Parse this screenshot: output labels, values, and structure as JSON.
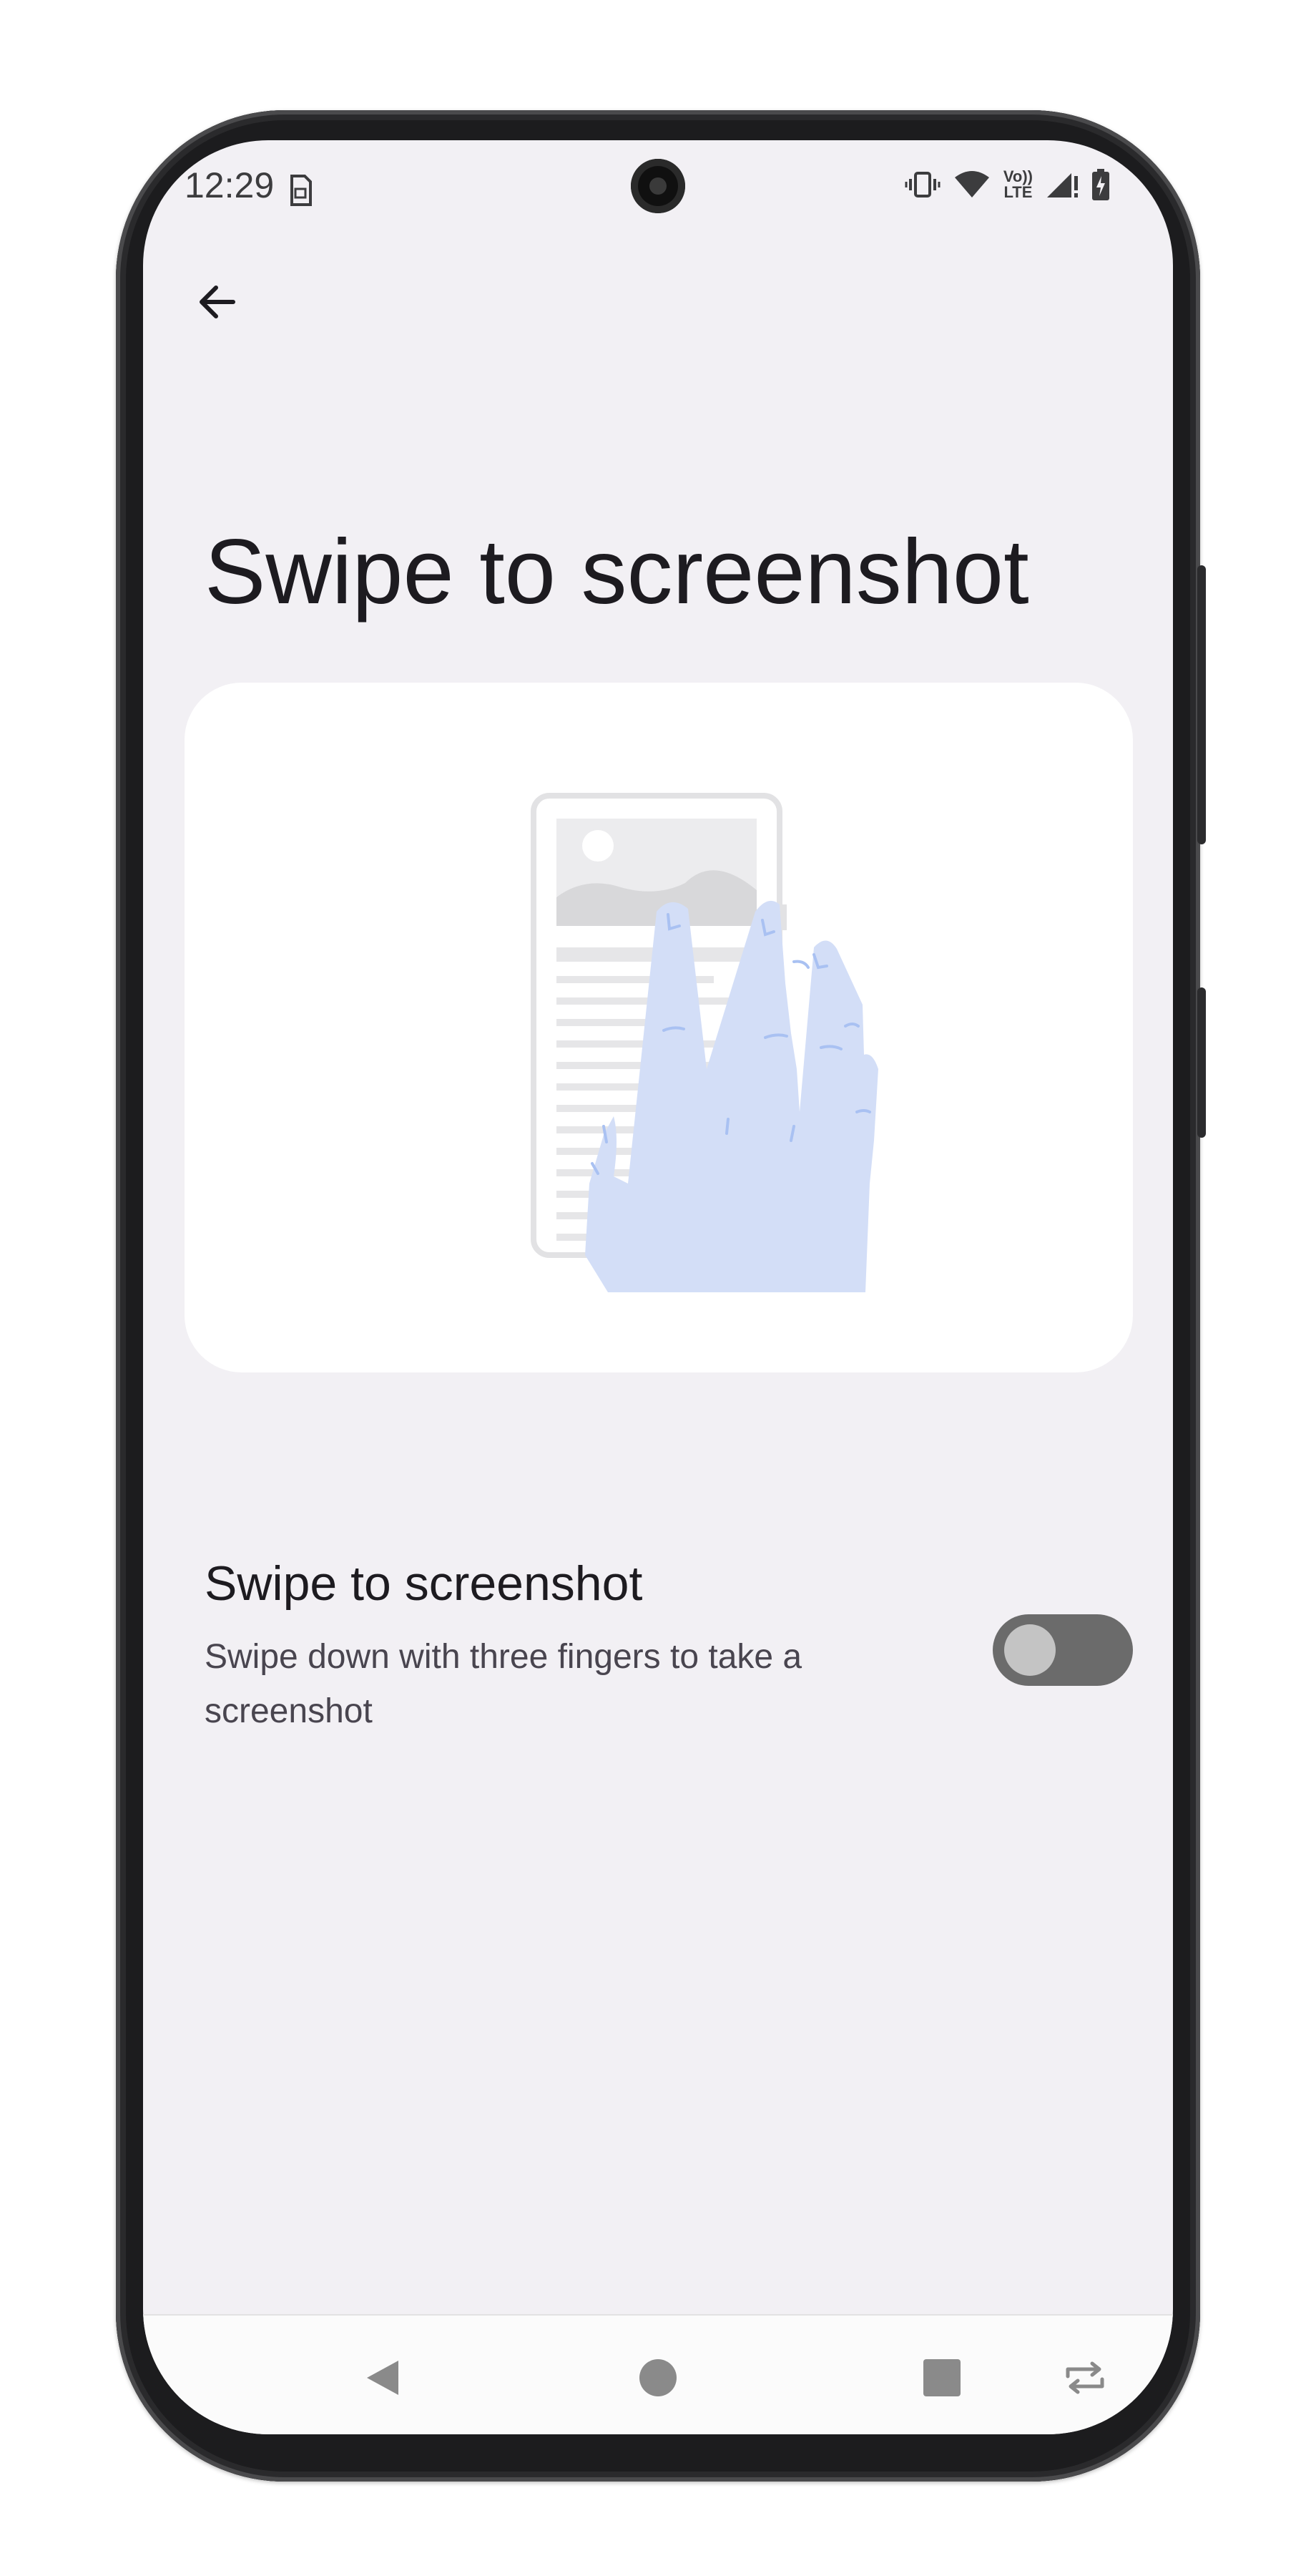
{
  "status_bar": {
    "time": "12:29",
    "icons": [
      "sim-card-icon",
      "vibrate-icon",
      "wifi-icon",
      "volte-icon",
      "cell-signal-icon",
      "battery-charging-icon"
    ],
    "volte_label_top": "Vo))",
    "volte_label_bottom": "LTE"
  },
  "header": {
    "back_icon": "arrow-back-icon",
    "page_title": "Swipe to screenshot"
  },
  "illustration": {
    "description_icon": "three-finger-swipe-illustration",
    "hand_color": "#d3def7",
    "hand_line_color": "#a9c1f2",
    "phone_color": "#e8e8ea"
  },
  "setting": {
    "title": "Swipe to screenshot",
    "description": "Swipe down with three fingers to take a screenshot",
    "toggle_state": "off"
  },
  "nav_bar": {
    "items": [
      "back-triangle-icon",
      "home-circle-icon",
      "recents-square-icon",
      "rotate-icon"
    ]
  },
  "colors": {
    "screen_background": "#f2f0f4",
    "card_background": "#ffffff",
    "title_text": "#1d1b20",
    "toggle_track_off": "#6b6b6b",
    "toggle_knob_off": "#c4c4c4"
  }
}
